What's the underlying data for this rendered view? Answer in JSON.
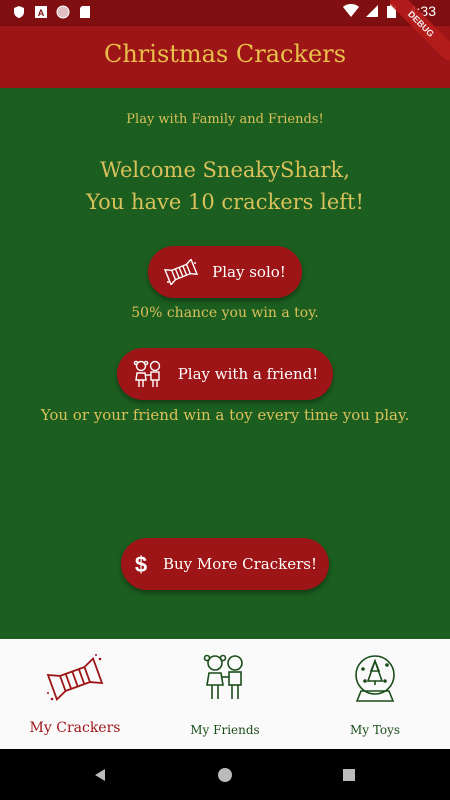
{
  "status_bar": {
    "time": "4:33",
    "icons": [
      "shield-icon",
      "a-icon",
      "circle-icon",
      "sd-card-icon",
      "wifi-icon",
      "signal-icon",
      "battery-icon"
    ]
  },
  "app_bar": {
    "title": "Christmas Crackers",
    "debug_banner": "DEBUG"
  },
  "main": {
    "tagline": "Play with Family and Friends!",
    "welcome_line1": "Welcome SneakyShark,",
    "welcome_line2": "You have 10 crackers left!",
    "solo_button_label": "Play solo!",
    "solo_hint": "50% chance you win a toy.",
    "friend_button_label": "Play with a friend!",
    "friend_hint": "You or your friend win a toy every time you play.",
    "buy_button_label": "Buy More Crackers!"
  },
  "bottom_nav": {
    "items": [
      {
        "label": "My Crackers",
        "icon": "cracker-icon",
        "selected": true
      },
      {
        "label": "My Friends",
        "icon": "friends-icon",
        "selected": false
      },
      {
        "label": "My Toys",
        "icon": "snow-globe-icon",
        "selected": false
      }
    ]
  },
  "colors": {
    "app_bar": "#9e1517",
    "status_bar": "#7f0f10",
    "background": "#1b5e20",
    "gold_text": "#d9c05a",
    "button": "#9e1517",
    "nav_selected": "#9e1517",
    "nav_unselected": "#1b4d1b"
  }
}
